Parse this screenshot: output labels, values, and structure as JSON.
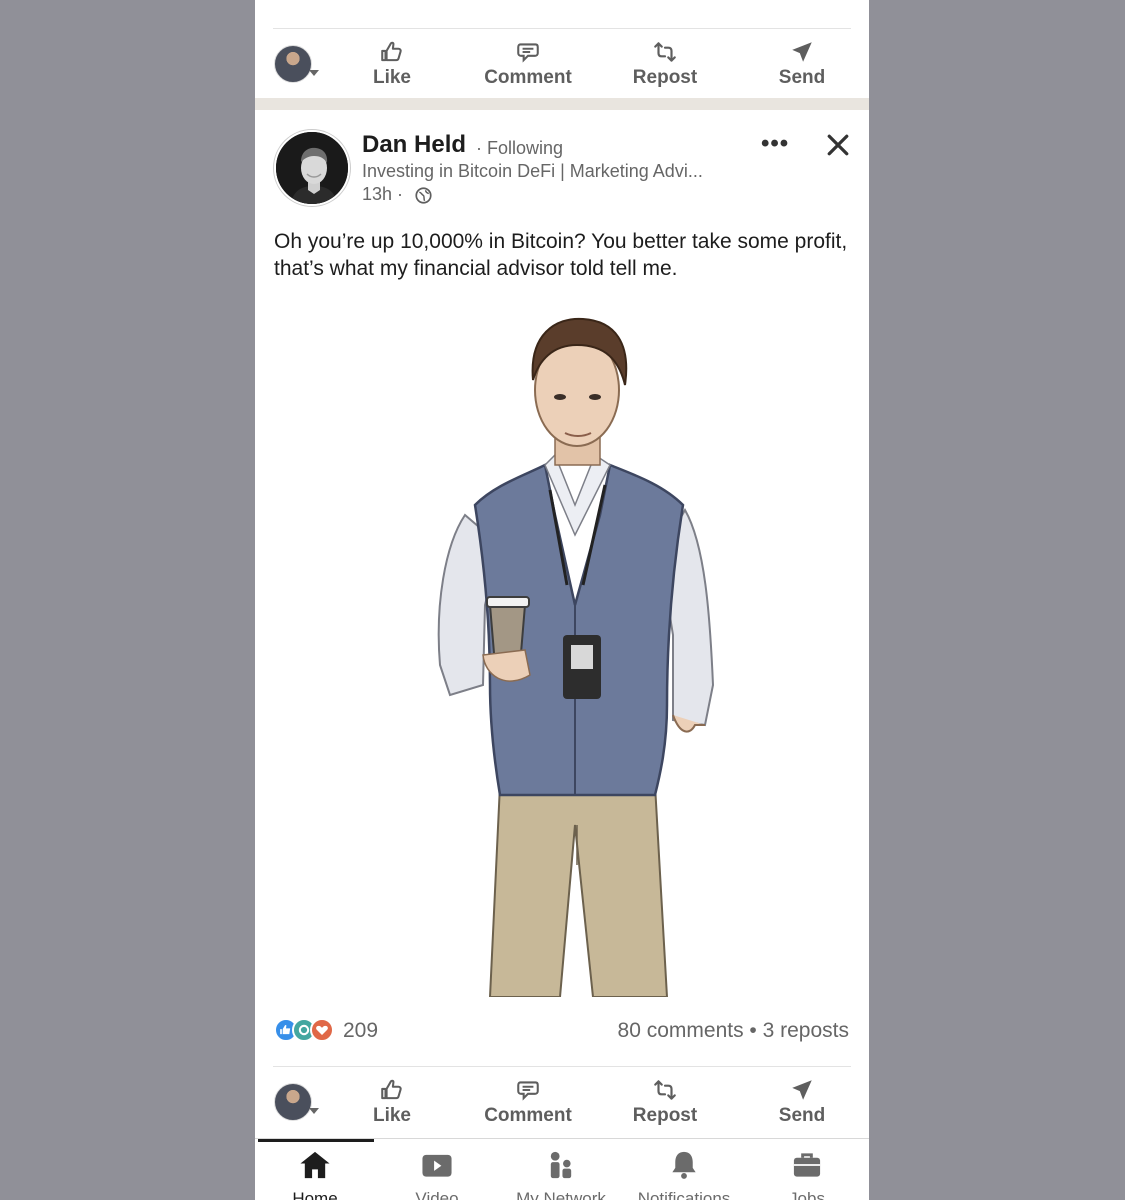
{
  "top_actions": {
    "like": "Like",
    "comment": "Comment",
    "repost": "Repost",
    "send": "Send"
  },
  "post": {
    "author": "Dan Held",
    "following": "· Following",
    "headline": "Investing in Bitcoin DeFi | Marketing Advi...",
    "time": "13h ·",
    "text": "Oh you’re up 10,000% in Bitcoin? You better take some profit, that’s what my financial advisor told tell me.",
    "image_icon": "illustration-man-with-coffee",
    "reaction_count": "209",
    "comments_reposts": "80 comments  •  3 reposts"
  },
  "bottom_actions": {
    "like": "Like",
    "comment": "Comment",
    "repost": "Repost",
    "send": "Send"
  },
  "nav": {
    "home": "Home",
    "video": "Video",
    "network": "My Network",
    "notifications": "Notifications",
    "jobs": "Jobs"
  },
  "colors": {
    "like_blue": "#378fe9",
    "celebrate_green": "#44a7a0",
    "love_red": "#e06847"
  }
}
